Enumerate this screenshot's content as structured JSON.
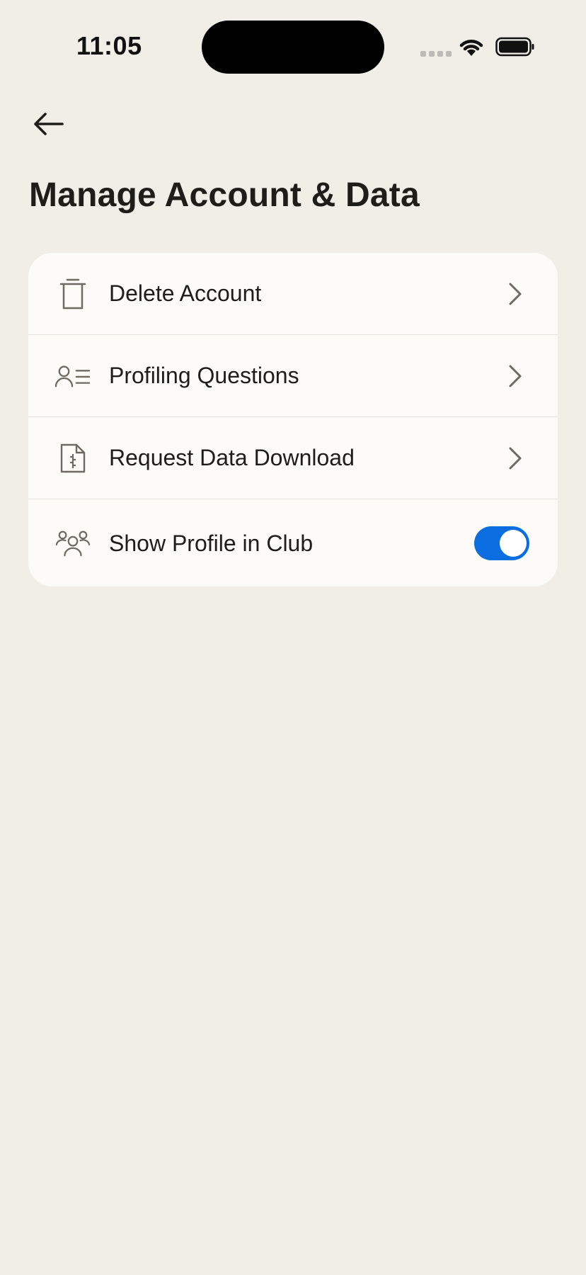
{
  "status_bar": {
    "time": "11:05",
    "icons": [
      "signal-dots-icon",
      "wifi-icon",
      "battery-icon"
    ]
  },
  "header": {
    "back_icon": "arrow-left-icon",
    "title": "Manage Account & Data"
  },
  "settings": {
    "items": [
      {
        "label": "Delete Account",
        "icon": "trash-icon",
        "accessory": "chevron-right-icon"
      },
      {
        "label": "Profiling Questions",
        "icon": "profile-list-icon",
        "accessory": "chevron-right-icon"
      },
      {
        "label": "Request Data Download",
        "icon": "document-zip-icon",
        "accessory": "chevron-right-icon"
      },
      {
        "label": "Show Profile in Club",
        "icon": "group-icon",
        "accessory": "toggle",
        "toggle_on": true
      }
    ]
  },
  "colors": {
    "background": "#f1eee8",
    "card": "#fcfbf8",
    "text": "#1f1d1a",
    "icon": "#6e6a61",
    "toggle_on": "#0a6de0",
    "divider": "#e6e2d9"
  }
}
